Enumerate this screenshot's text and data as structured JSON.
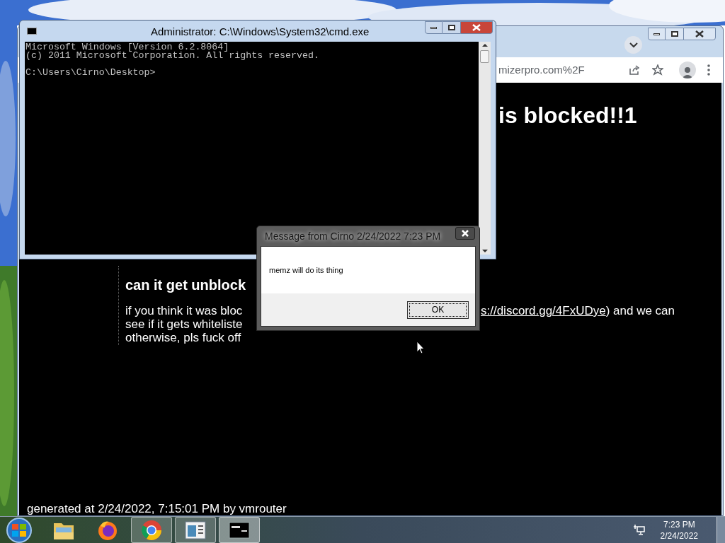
{
  "browser": {
    "address": "mizerpro.com%2F",
    "heading": "is blocked!!1",
    "subheading": "can it get unblock",
    "paragraph": {
      "line_1_start": "if you think it was bloc",
      "link": "s://discord.gg/4FxUDye",
      "line_1_end": ") and we can",
      "line_2": "see if it gets whiteliste",
      "line_3": "otherwise, pls fuck off"
    },
    "footer": "generated at 2/24/2022, 7:15:01 PM by vmrouter"
  },
  "cmd_window": {
    "title": "Administrator: C:\\Windows\\System32\\cmd.exe",
    "output": [
      "Microsoft Windows [Version 6.2.8064]",
      "(c) 2011 Microsoft Corporation. All rights reserved."
    ],
    "prompt": "C:\\Users\\Cirno\\Desktop>"
  },
  "dialog": {
    "title": "Message from Cirno 2/24/2022 7:23 PM",
    "message": "memz will do its thing",
    "button": "OK"
  },
  "taskbar": {
    "items": [
      {
        "kind": "folder",
        "running": false,
        "selected": false
      },
      {
        "kind": "firefox",
        "running": false,
        "selected": false
      },
      {
        "kind": "chrome",
        "running": true,
        "selected": false
      },
      {
        "kind": "window",
        "running": true,
        "selected": false
      },
      {
        "kind": "console",
        "running": true,
        "selected": true
      }
    ],
    "clock": {
      "time": "7:23 PM",
      "date": "2/24/2022"
    }
  }
}
